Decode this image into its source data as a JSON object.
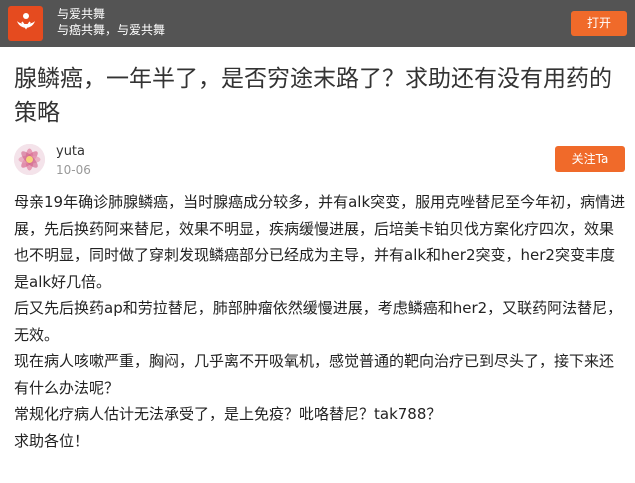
{
  "app_bar": {
    "icon": "logo-icon",
    "name": "与爱共舞",
    "slogan": "与癌共舞，与爱共舞",
    "open_label": "打开"
  },
  "post": {
    "title": "腺鳞癌，一年半了，是否穷途末路了？求助还有没有用药的策略",
    "author": {
      "username": "yuta",
      "date": "10-06",
      "follow_label": "关注Ta"
    },
    "paragraphs": [
      "母亲19年确诊肺腺鳞癌，当时腺癌成分较多，并有alk突变，服用克唑替尼至今年初，病情进展，先后换药阿来替尼，效果不明显，疾病缓慢进展，后培美卡铂贝伐方案化疗四次，效果也不明显，同时做了穿刺发现鳞癌部分已经成为主导，并有alk和her2突变，her2突变丰度是alk好几倍。",
      "后又先后换药ap和劳拉替尼，肺部肿瘤依然缓慢进展，考虑鳞癌和her2，又联药阿法替尼，无效。",
      "现在病人咳嗽严重，胸闷，几乎离不开吸氧机，感觉普通的靶向治疗已到尽头了，接下来还有什么办法呢？",
      "常规化疗病人估计无法承受了，是上免疫？吡咯替尼？tak788？",
      "求助各位！"
    ]
  },
  "colors": {
    "top_bar": "#545454",
    "accent": "#f06a2a",
    "logo_bg": "#e54b1f"
  }
}
